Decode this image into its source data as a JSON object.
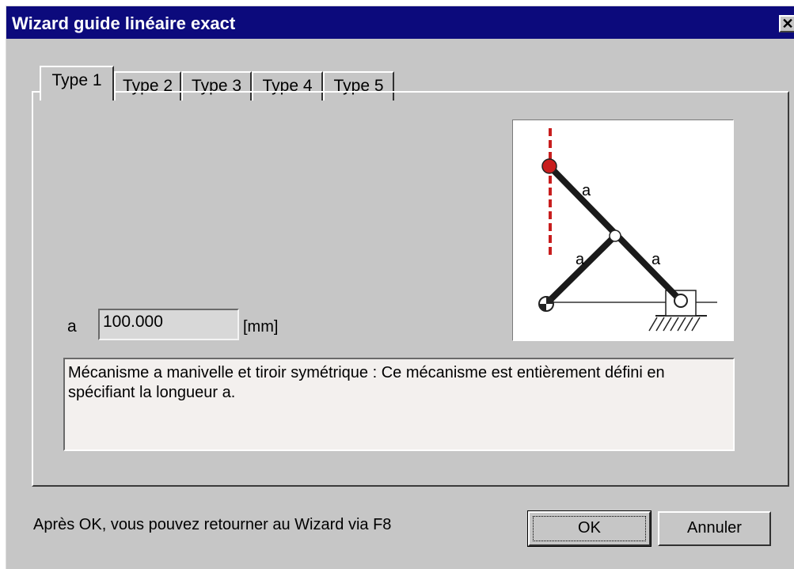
{
  "window": {
    "title": "Wizard guide linéaire exact",
    "close_glyph": "✕"
  },
  "tabs": [
    {
      "label": "Type 1",
      "active": true
    },
    {
      "label": "Type 2",
      "active": false
    },
    {
      "label": "Type 3",
      "active": false
    },
    {
      "label": "Type 4",
      "active": false
    },
    {
      "label": "Type 5",
      "active": false
    }
  ],
  "diagram": {
    "link_labels": [
      "a",
      "a",
      "a"
    ],
    "colors": {
      "guide_line": "#c81e1e",
      "tracer_point": "#c81e1e",
      "link": "#1a1a1a"
    }
  },
  "param": {
    "label": "a",
    "value": "100.000",
    "unit": "[mm]"
  },
  "description": "Mécanisme a manivelle et tiroir symétrique : Ce mécanisme est entièrement défini en spécifiant la longueur a.",
  "footer": {
    "note": "Après OK, vous pouvez retourner au Wizard via F8",
    "ok_label": "OK",
    "cancel_label": "Annuler"
  }
}
